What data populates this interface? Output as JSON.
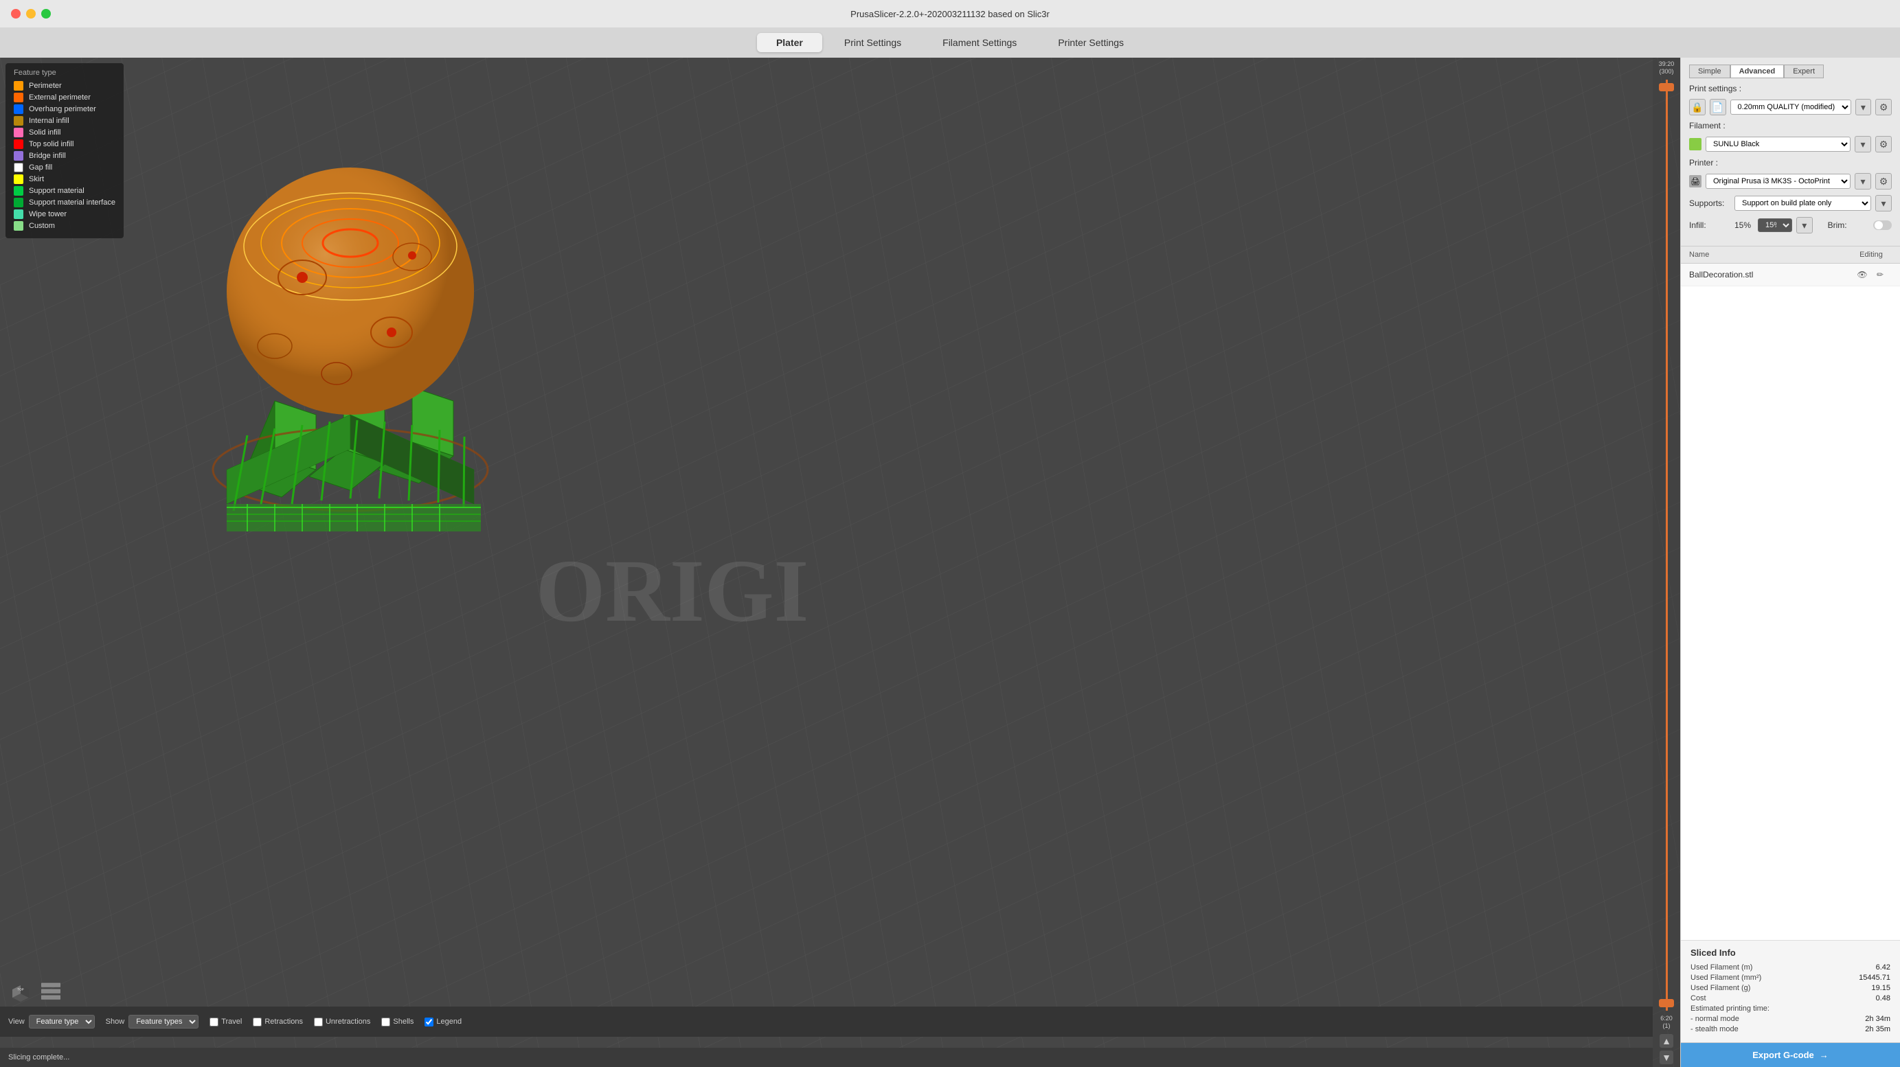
{
  "window": {
    "title": "PrusaSlicer-2.2.0+-202003211132 based on Slic3r"
  },
  "traffic_lights": {
    "close": "close",
    "minimize": "minimize",
    "maximize": "maximize"
  },
  "menu_tabs": [
    {
      "id": "plater",
      "label": "Plater",
      "active": true
    },
    {
      "id": "print_settings",
      "label": "Print Settings",
      "active": false
    },
    {
      "id": "filament_settings",
      "label": "Filament Settings",
      "active": false
    },
    {
      "id": "printer_settings",
      "label": "Printer Settings",
      "active": false
    }
  ],
  "legend": {
    "title": "Feature type",
    "items": [
      {
        "label": "Perimeter",
        "color": "#ff9900"
      },
      {
        "label": "External perimeter",
        "color": "#ff6600"
      },
      {
        "label": "Overhang perimeter",
        "color": "#0066ff"
      },
      {
        "label": "Internal infill",
        "color": "#b8860b"
      },
      {
        "label": "Solid infill",
        "color": "#ff69b4"
      },
      {
        "label": "Top solid infill",
        "color": "#ff0000"
      },
      {
        "label": "Bridge infill",
        "color": "#9370db"
      },
      {
        "label": "Gap fill",
        "color": "#ffffff"
      },
      {
        "label": "Skirt",
        "color": "#ffff00"
      },
      {
        "label": "Support material",
        "color": "#00cc44"
      },
      {
        "label": "Support material interface",
        "color": "#00aa33"
      },
      {
        "label": "Wipe tower",
        "color": "#44ddaa"
      },
      {
        "label": "Custom",
        "color": "#88dd88"
      }
    ]
  },
  "view_controls": {
    "view_label": "View",
    "view_value": "Feature type",
    "show_label": "Show",
    "show_value": "Feature types",
    "travel_label": "Travel",
    "travel_checked": false,
    "retractions_label": "Retractions",
    "retractions_checked": false,
    "unretractions_label": "Unretractions",
    "unretractions_checked": false,
    "shells_label": "Shells",
    "shells_checked": false,
    "legend_label": "Legend",
    "legend_checked": true
  },
  "status_bar": {
    "message": "Slicing complete..."
  },
  "slider": {
    "top_label1": "39:20",
    "top_label2": "(300)",
    "bottom_label1": "6:20",
    "bottom_label2": "(1)"
  },
  "right_panel": {
    "mode_tabs": [
      {
        "id": "simple",
        "label": "Simple",
        "active": false
      },
      {
        "id": "advanced",
        "label": "Advanced",
        "active": true
      },
      {
        "id": "expert",
        "label": "Expert",
        "active": false
      }
    ],
    "print_settings_label": "Print settings :",
    "print_quality": "0.20mm QUALITY (modified)",
    "filament_label": "Filament :",
    "filament_color": "#88cc44",
    "filament_name": "SUNLU Black",
    "printer_label": "Printer :",
    "printer_icon": "printer",
    "printer_name": "Original Prusa i3 MK3S - OctoPrint",
    "supports_label": "Supports:",
    "supports_value": "Support on build plate only",
    "infill_label": "Infill:",
    "infill_value": "15%",
    "brim_label": "Brim:",
    "object_list_headers": {
      "name": "Name",
      "editing": "Editing"
    },
    "objects": [
      {
        "name": "BallDecoration.stl",
        "visible": true,
        "editable": true
      }
    ],
    "sliced_info": {
      "title": "Sliced Info",
      "rows": [
        {
          "label": "Used Filament (m)",
          "value": "6.42"
        },
        {
          "label": "Used Filament (mm²)",
          "value": "15445.71"
        },
        {
          "label": "Used Filament (g)",
          "value": "19.15"
        },
        {
          "label": "Cost",
          "value": "0.48"
        },
        {
          "label": "Estimated printing time:",
          "value": ""
        },
        {
          "label": "- normal mode",
          "value": "2h 34m"
        },
        {
          "label": "- stealth mode",
          "value": "2h 35m"
        }
      ]
    },
    "export_btn_label": "Export G-code"
  },
  "origin_text": "ORIGI",
  "icons": {
    "gear": "⚙",
    "eye": "👁",
    "edit": "✏",
    "dropdown": "▾",
    "checkbox_checked": "✓",
    "export_arrow": "→"
  }
}
